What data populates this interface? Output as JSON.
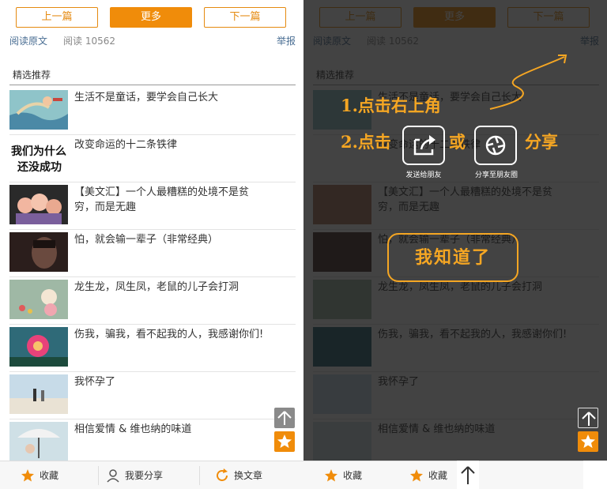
{
  "nav": {
    "prev_label": "上一篇",
    "more_label": "更多",
    "next_label": "下一篇"
  },
  "meta": {
    "read_original": "阅读原文",
    "read_count": "阅读 10562",
    "report": "举报"
  },
  "section": {
    "title": "精选推荐"
  },
  "articles": [
    {
      "title": "生活不是童话，要学会自己长大",
      "thumb": "illustration"
    },
    {
      "title": "改变命运的十二条铁律",
      "thumb": "calligraphy",
      "thumb_text_1": "我们为什么",
      "thumb_text_2": "还没成功"
    },
    {
      "title": "【美文汇】一个人最糟糕的处境不是贫穷，而是无趣",
      "thumb": "dolls"
    },
    {
      "title": "怕，就会输一辈子（非常经典）",
      "thumb": "dark-portrait"
    },
    {
      "title": "龙生龙，凤生凤，老鼠的儿子会打洞",
      "thumb": "cartoon"
    },
    {
      "title": "伤我，骗我，看不起我的人，我感谢你们!",
      "thumb": "flower"
    },
    {
      "title": "我怀孕了",
      "thumb": "beach"
    },
    {
      "title": "相信爱情 & 维也纳的味道",
      "thumb": "umbrella"
    }
  ],
  "bottom_bar": {
    "favorite_label": "收藏",
    "share_label": "我要分享",
    "change_label": "换文章"
  },
  "overlay": {
    "step1": "1.点击右上角",
    "step2_prefix": "2.点击",
    "step2_or": "或",
    "step2_share": "分享",
    "send_friend_caption": "发送给朋友",
    "share_moments_caption": "分享至朋友圈",
    "got_it_label": "我知道了"
  },
  "colors": {
    "accent": "#f08c0a",
    "hint": "#f5a623",
    "link": "#4a6e93"
  }
}
